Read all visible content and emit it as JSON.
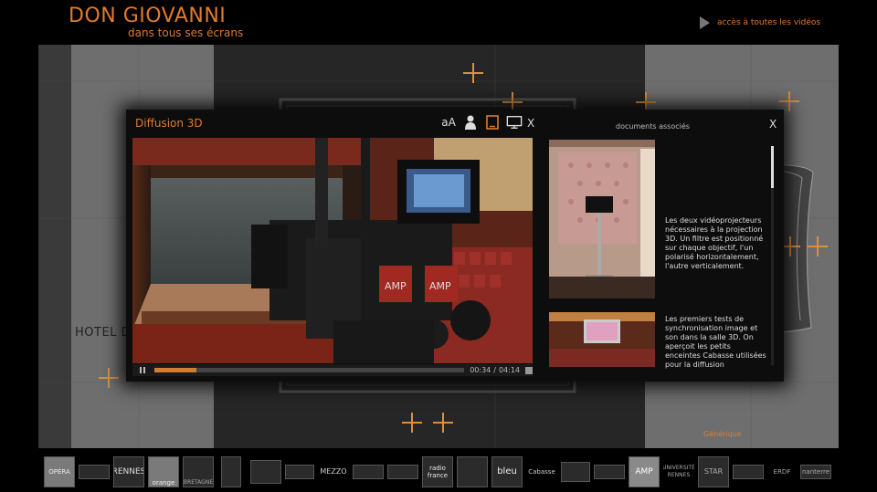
{
  "header": {
    "title": "DON GIOVANNI",
    "subtitle": "dans tous ses écrans",
    "all_videos_label": "accès à toutes les vidéos"
  },
  "stage": {
    "hotel_label": "HOTEL DE",
    "credits_label": "Générique"
  },
  "modal": {
    "title": "Diffusion 3D",
    "tools": [
      "text-size-icon",
      "user-icon",
      "tablet-icon",
      "desktop-icon"
    ],
    "text_size_glyph": "aA",
    "close_label": "X",
    "player": {
      "progress": 0.135,
      "current_time": "00:34",
      "separator": "/",
      "duration": "04:14"
    },
    "documents": {
      "title": "documents associés",
      "close_label": "X",
      "items": [
        {
          "text": "Les deux vidéoprojecteurs nécessaires à la projection 3D. Un filtre est positionné sur chaque objectif, l'un polarisé horizontalement, l'autre verticalement."
        },
        {
          "text": "Les premiers tests de synchronisation image et son dans la salle 3D. On aperçoit les petits enceintes Cabasse utilisées pour la diffusion"
        }
      ]
    }
  },
  "footer": {
    "logos": [
      "OPÉRA",
      "RENNES",
      "orange",
      "BRETAGNE",
      "MEZZO",
      "radio france",
      "bleu",
      "Cabasse",
      "AMP",
      "UNIVERSITÉ RENNES",
      "STAR",
      "ERDF",
      "nanterre"
    ]
  },
  "colors": {
    "accent": "#e07a2c",
    "background": "#000000",
    "stage": "#3a3a3a"
  }
}
